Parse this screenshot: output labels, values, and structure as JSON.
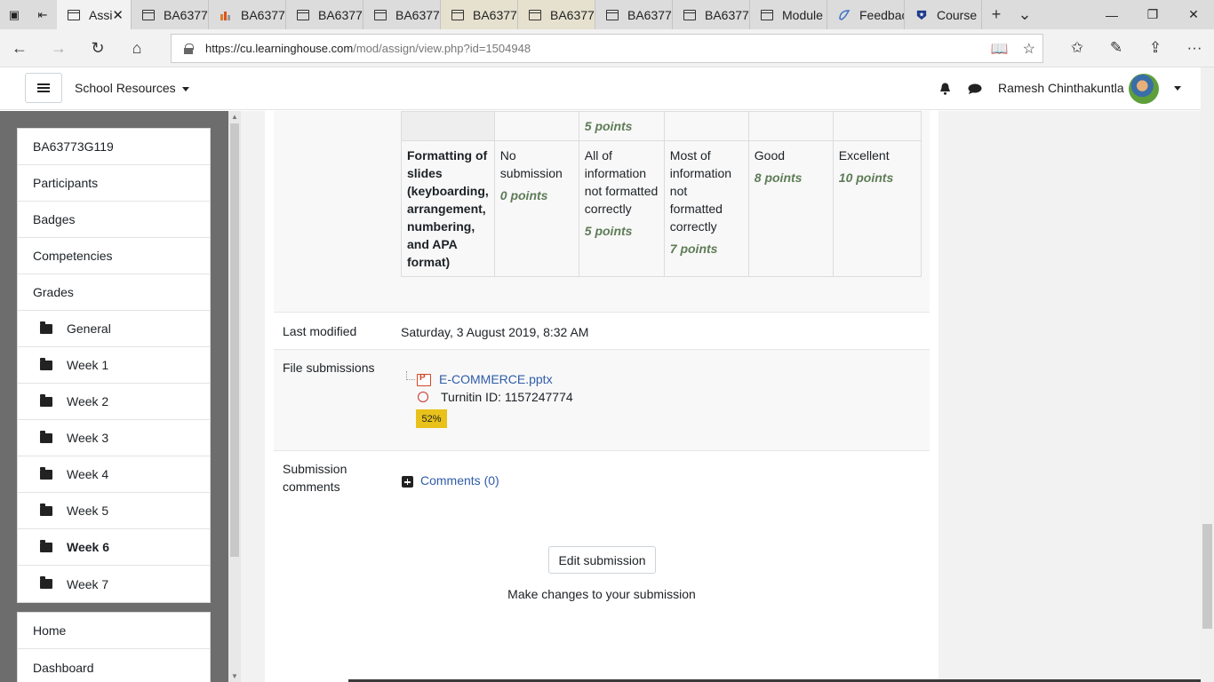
{
  "browser": {
    "tabs": [
      {
        "label": "Assi",
        "active": true
      },
      {
        "label": "BA6377"
      },
      {
        "label": "BA6377"
      },
      {
        "label": "BA6377"
      },
      {
        "label": "BA6377"
      },
      {
        "label": "BA6377"
      },
      {
        "label": "BA6377"
      },
      {
        "label": "BA6377"
      },
      {
        "label": "BA6377"
      },
      {
        "label": "Module"
      },
      {
        "label": "Feedbac"
      },
      {
        "label": "Course"
      }
    ],
    "url_domain": "https://cu.learninghouse.com",
    "url_path": "/mod/assign/view.php?id=1504948"
  },
  "header": {
    "site_menu": "School Resources",
    "user_name": "Ramesh Chinthakuntla"
  },
  "drawer": {
    "course_items": [
      {
        "label": "BA63773G119"
      },
      {
        "label": "Participants"
      },
      {
        "label": "Badges"
      },
      {
        "label": "Competencies"
      },
      {
        "label": "Grades"
      },
      {
        "label": "General"
      },
      {
        "label": "Week 1"
      },
      {
        "label": "Week 2"
      },
      {
        "label": "Week 3"
      },
      {
        "label": "Week 4"
      },
      {
        "label": "Week 5"
      },
      {
        "label": "Week 6"
      },
      {
        "label": "Week 7"
      }
    ],
    "site_items": [
      {
        "label": "Home"
      },
      {
        "label": "Dashboard"
      }
    ]
  },
  "rubric": {
    "top_row_partial": "5 points",
    "criterion": "Formatting of slides (keyboarding, arrangement, numbering, and APA format)",
    "levels": [
      {
        "text": "No submission",
        "points": "0 points"
      },
      {
        "text": "All of information not formatted correctly",
        "points": "5 points"
      },
      {
        "text": "Most of information not formatted correctly",
        "points": "7 points"
      },
      {
        "text": "Good",
        "points": "8 points"
      },
      {
        "text": "Excellent",
        "points": "10 points"
      }
    ]
  },
  "status": {
    "last_modified_label": "Last modified",
    "last_modified_value": "Saturday, 3 August 2019, 8:32 AM",
    "file_submissions_label": "File submissions",
    "file_name": "E-COMMERCE.pptx",
    "turnitin": "Turnitin ID: 1157247774",
    "similarity": "52%",
    "submission_comments_label": "Submission comments",
    "comments_link": "Comments (0)"
  },
  "actions": {
    "edit_button": "Edit submission",
    "edit_help": "Make changes to your submission"
  }
}
